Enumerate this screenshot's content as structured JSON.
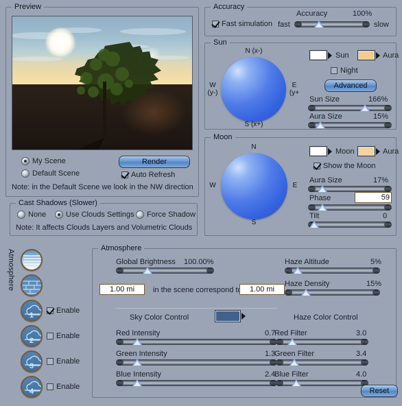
{
  "preview": {
    "legend": "Preview",
    "radio_my_scene": "My Scene",
    "radio_default_scene": "Default Scene",
    "render_button": "Render",
    "auto_refresh": "Auto Refresh",
    "note": "Note: in the Default Scene we look in the NW direction"
  },
  "cast_shadows": {
    "legend": "Cast Shadows (Slower)",
    "option_none": "None",
    "option_use_clouds": "Use Clouds Settings",
    "option_force_shadow": "Force Shadow",
    "note": "Note: It affects Clouds Layers and Volumetric Clouds"
  },
  "accuracy": {
    "legend": "Accuracy",
    "fast_simulation": "Fast simulation",
    "slider_label": "Accuracy",
    "value": "100%",
    "min_label": "fast",
    "max_label": "slow",
    "thumb_pct": 33
  },
  "sun": {
    "legend": "Sun",
    "compass_n": "N (x-)",
    "compass_s": "S (x+)",
    "compass_w": "W\n(y-)",
    "compass_e": "E\n(y+",
    "color_sun_label": "Sun",
    "color_aura_label": "Aura",
    "color_sun_hex": "#ffffff",
    "color_aura_hex": "#f5cc8f",
    "night": "Night",
    "advanced_button": "Advanced",
    "sun_size_label": "Sun Size",
    "sun_size_value": "166%",
    "sun_size_pct": 68,
    "aura_size_label": "Aura Size",
    "aura_size_value": "15%",
    "aura_size_pct": 15
  },
  "moon": {
    "legend": "Moon",
    "compass_n": "N",
    "compass_s": "S",
    "compass_w": "W",
    "compass_e": "E",
    "color_moon_label": "Moon",
    "color_aura_label": "Aura",
    "color_moon_hex": "#ffffff",
    "color_aura_hex": "#f3d3a0",
    "show_the_moon": "Show the Moon",
    "aura_size_label": "Aura Size",
    "aura_size_value": "17%",
    "aura_size_pct": 17,
    "phase_label": "Phase",
    "phase_value": "59",
    "phase_pct": 17,
    "tilt_label": "Tilt",
    "tilt_value": "0",
    "tilt_pct": 7
  },
  "atmosphere": {
    "side_label": "Atmosphere",
    "legend": "Atmosphere",
    "global_brightness_label": "Global Brightness",
    "global_brightness_value": "100.00%",
    "global_brightness_pct": 32,
    "scale_from": "1.00 mi",
    "scale_text": "in the scene correspond to",
    "scale_to": "1.00 mi",
    "sky_color_control": "Sky Color Control",
    "sky_color_hex": "#43618c",
    "haze_color_control": "Haze Color Control",
    "haze_altitude_label": "Haze Altitude",
    "haze_altitude_value": "5%",
    "haze_altitude_pct": 14,
    "haze_density_label": "Haze Density",
    "haze_density_value": "15%",
    "haze_density_pct": 22,
    "reset_button": "Reset",
    "sky_sliders": [
      {
        "label": "Red Intensity",
        "value": "0.7",
        "pct": 13
      },
      {
        "label": "Green Intensity",
        "value": "1.3",
        "pct": 13
      },
      {
        "label": "Blue Intensity",
        "value": "2.4",
        "pct": 13
      }
    ],
    "haze_sliders": [
      {
        "label": "Red Filter",
        "value": "3.0",
        "pct": 18
      },
      {
        "label": "Green Filter",
        "value": "3.4",
        "pct": 20
      },
      {
        "label": "Blue Filter",
        "value": "4.0",
        "pct": 22
      }
    ],
    "layers": [
      {
        "enable_label": "",
        "number": ""
      },
      {
        "enable_label": "",
        "number": ""
      },
      {
        "enable_label": "Enable",
        "number": "1",
        "checked": true
      },
      {
        "enable_label": "Enable",
        "number": "2",
        "checked": false
      },
      {
        "enable_label": "Enable",
        "number": "3",
        "checked": false
      },
      {
        "enable_label": "Enable",
        "number": "4",
        "checked": false
      }
    ]
  }
}
